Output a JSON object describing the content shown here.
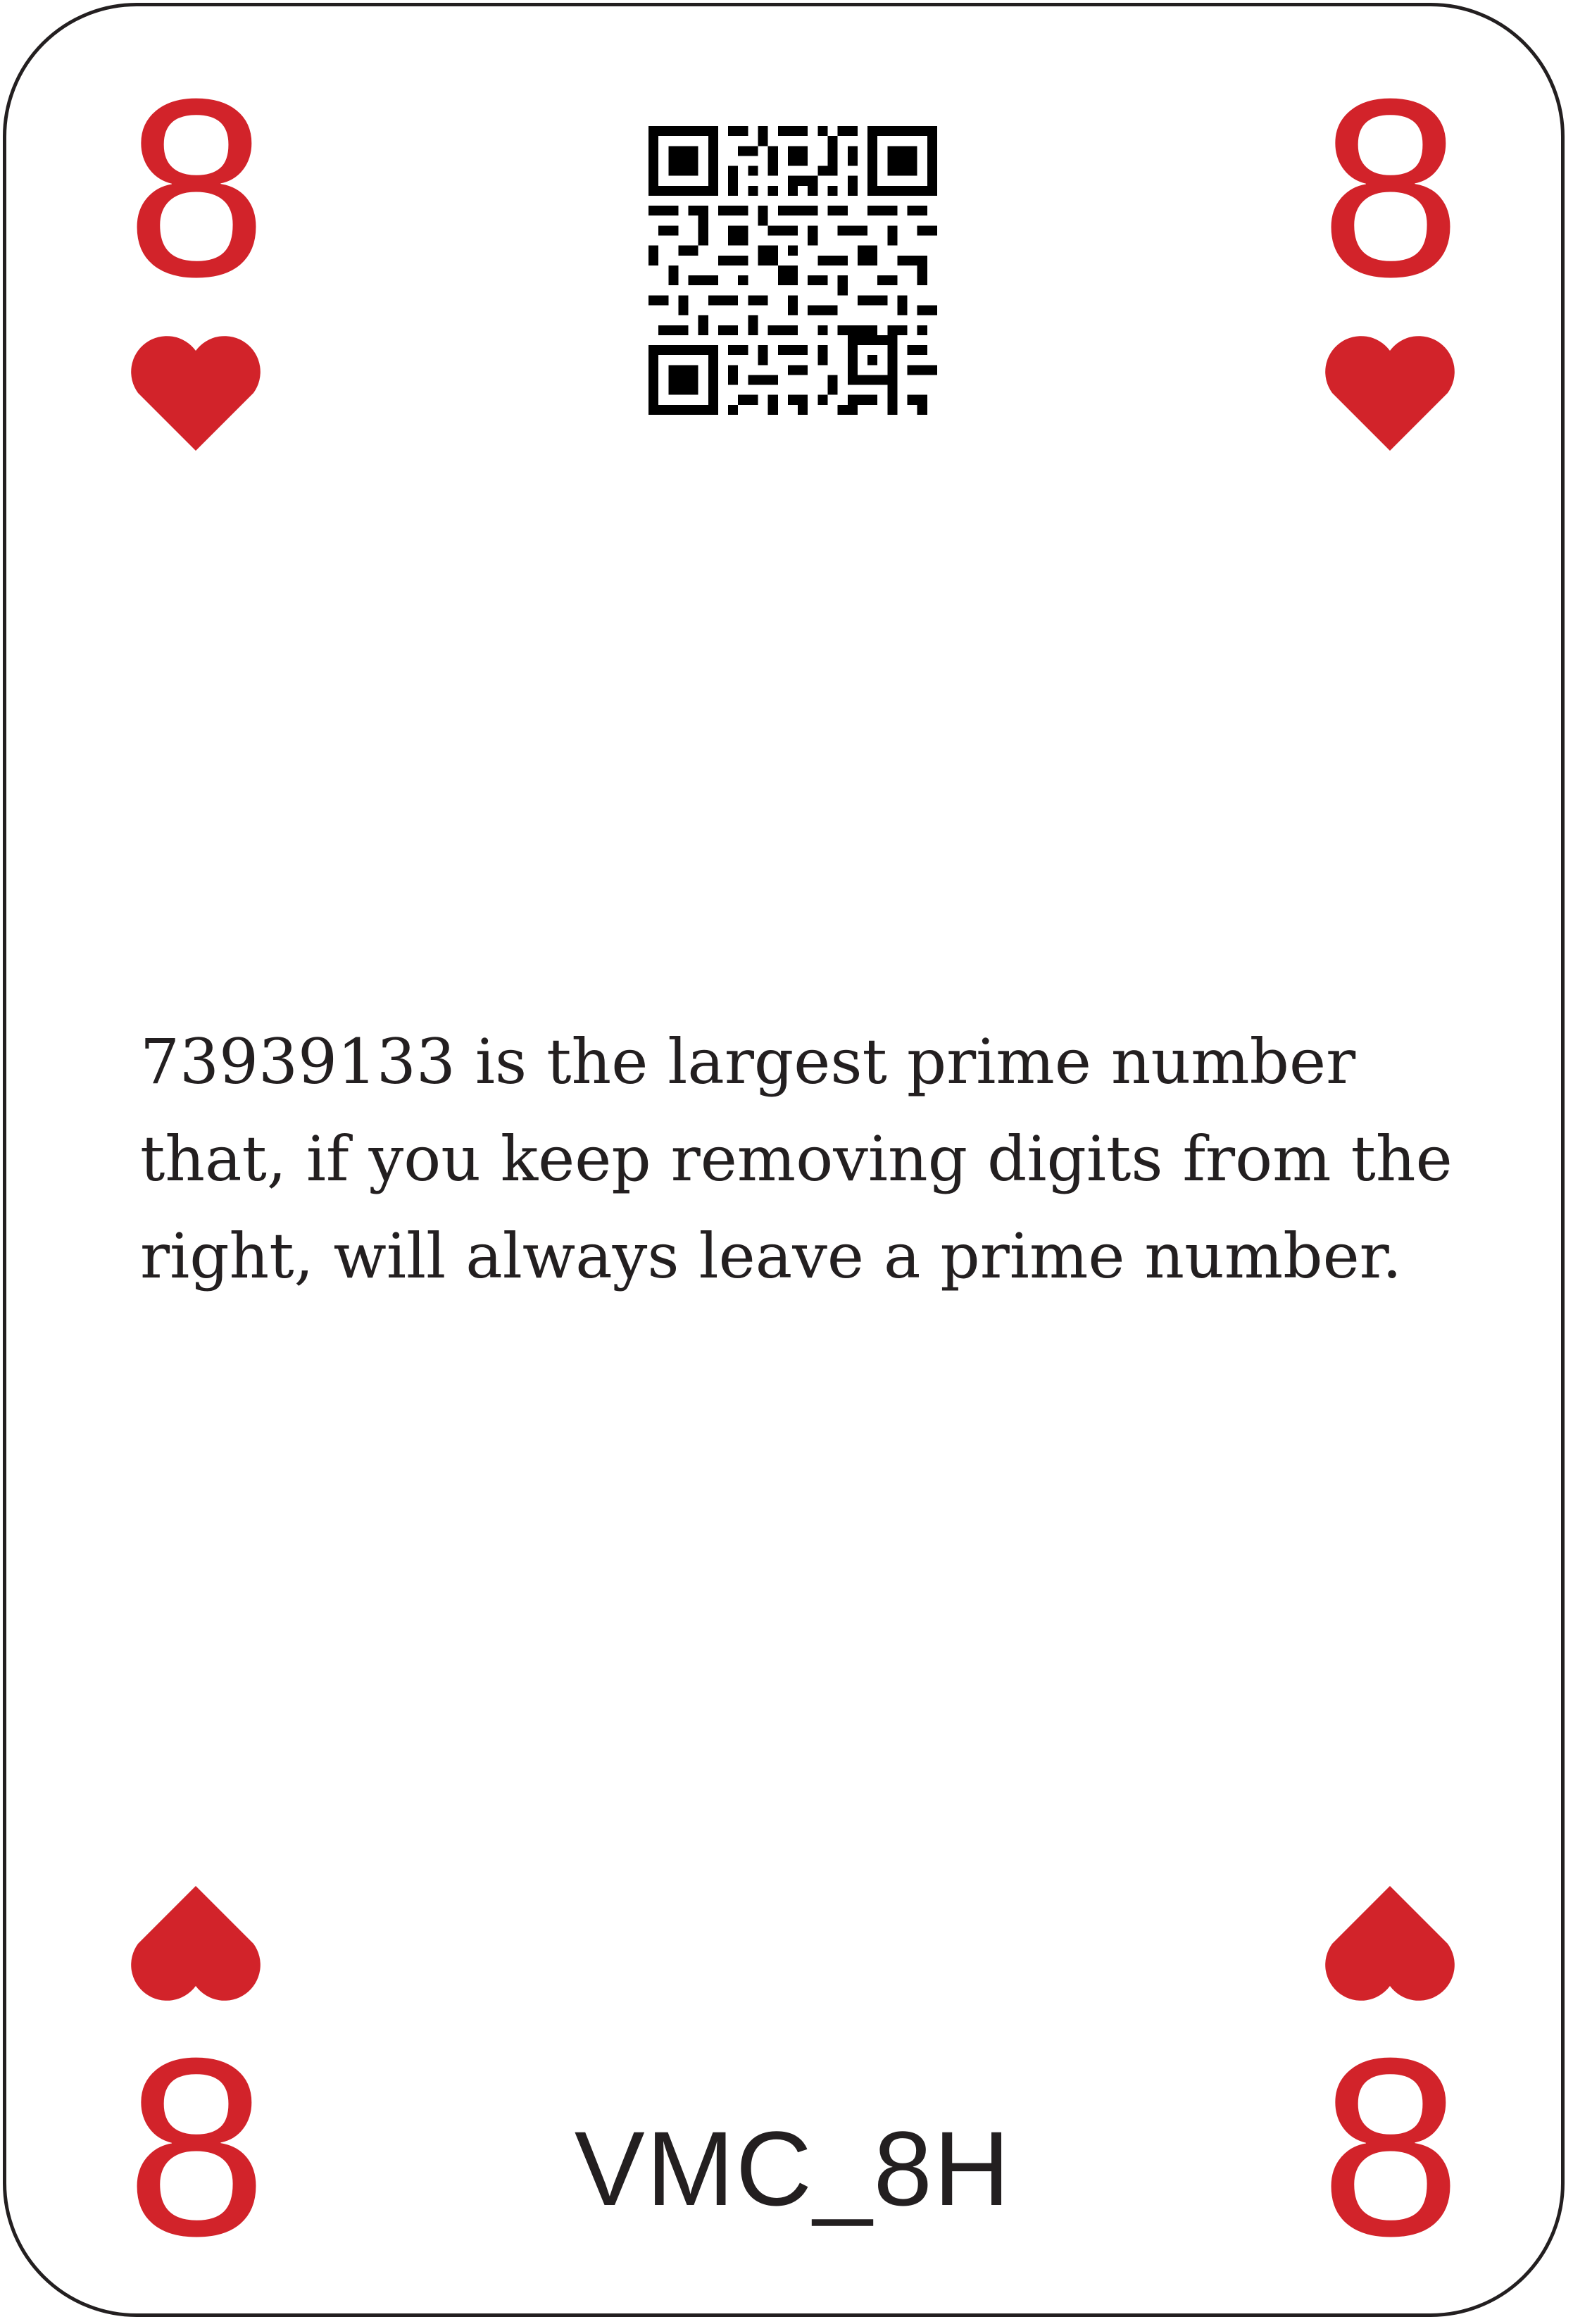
{
  "card": {
    "rank": "8",
    "suit_icon": "heart-icon",
    "suit_color": "#d2232a",
    "text_color": "#231f20",
    "border_color": "#231f20",
    "qr_icon": "qr-code-icon",
    "fact_lines": [
      "73939133 is the largest prime number",
      "that, if you keep removing digits from the",
      "right, will always leave a prime number."
    ],
    "code": "VMC_8H"
  }
}
